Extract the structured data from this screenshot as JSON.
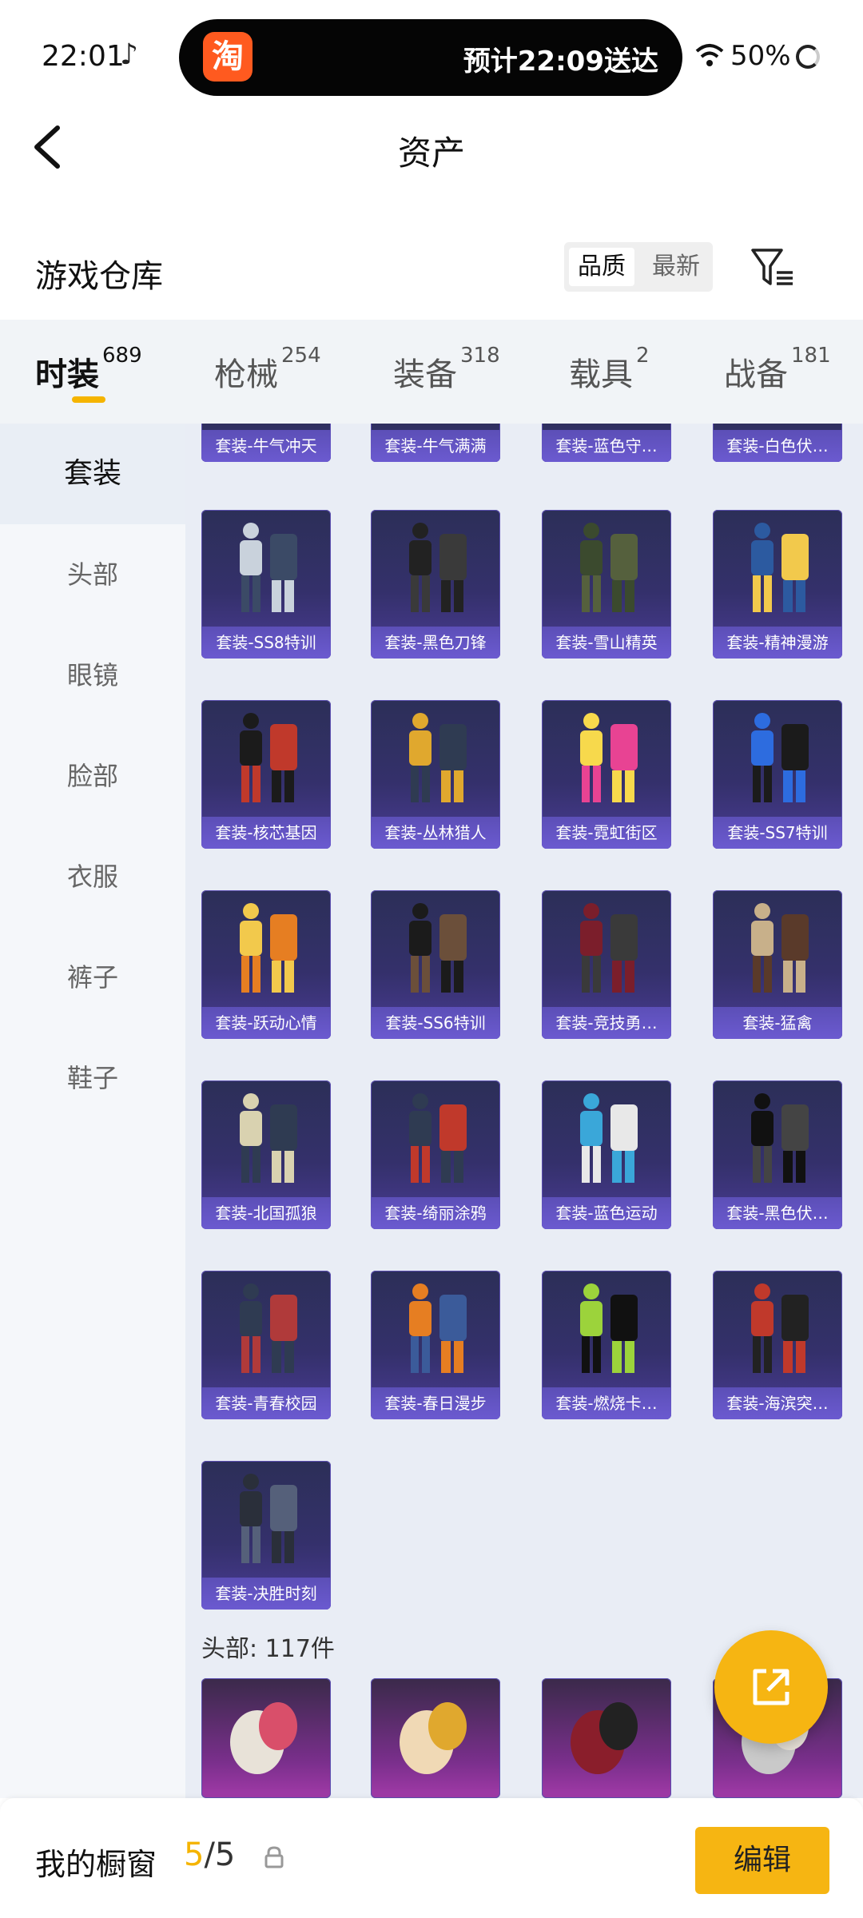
{
  "status_bar": {
    "time": "22:01",
    "delivery_text": "预计22:09送达",
    "app_logo": "淘",
    "battery": "50%"
  },
  "nav": {
    "title": "资产"
  },
  "section": {
    "title": "游戏仓库",
    "sort_options": [
      "品质",
      "最新"
    ]
  },
  "tabs": [
    {
      "label": "时装",
      "count": "689",
      "active": true
    },
    {
      "label": "枪械",
      "count": "254"
    },
    {
      "label": "装备",
      "count": "318"
    },
    {
      "label": "载具",
      "count": "2"
    },
    {
      "label": "战备",
      "count": "181"
    }
  ],
  "sidebar": [
    {
      "label": "套装",
      "active": true
    },
    {
      "label": "头部"
    },
    {
      "label": "眼镜"
    },
    {
      "label": "脸部"
    },
    {
      "label": "衣服"
    },
    {
      "label": "裤子"
    },
    {
      "label": "鞋子"
    }
  ],
  "partial_row": [
    "套装-牛气冲天",
    "套装-牛气满满",
    "套装-蓝色守…",
    "套装-白色伏…"
  ],
  "items": [
    "套装-SS8特训",
    "套装-黑色刀锋",
    "套装-雪山精英",
    "套装-精神漫游",
    "套装-核芯基因",
    "套装-丛林猎人",
    "套装-霓虹街区",
    "套装-SS7特训",
    "套装-跃动心情",
    "套装-SS6特训",
    "套装-竞技勇…",
    "套装-猛禽",
    "套装-北国孤狼",
    "套装-绮丽涂鸦",
    "套装-蓝色运动",
    "套装-黑色伏…",
    "套装-青春校园",
    "套装-春日漫步",
    "套装-燃烧卡…",
    "套装-海滨突…",
    "套装-决胜时刻"
  ],
  "head_section": {
    "count_label": "头部: 117件"
  },
  "bottom_bar": {
    "label": "我的橱窗",
    "current": "5",
    "total": "/5",
    "edit_label": "编辑"
  }
}
